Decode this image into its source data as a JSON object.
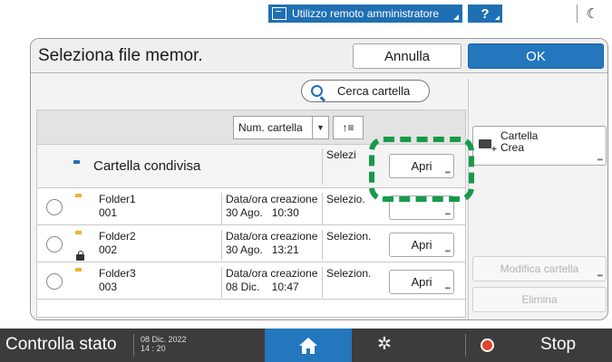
{
  "topbar": {
    "remote_label": "Utilizzo remoto amministratore",
    "help_label": "?",
    "moon_icon": "moon-icon"
  },
  "dialog": {
    "title": "Seleziona file memor.",
    "cancel_label": "Annulla",
    "ok_label": "OK",
    "search_label": "Cerca cartella",
    "sort_label": "Num. cartella",
    "sort_arrow": "▼",
    "sort_dir_label": "↑≡",
    "shared_folder": {
      "name": "Cartella condivisa",
      "select_label": "Selezi",
      "open_label": "Apri"
    },
    "rows": [
      {
        "name": "Folder1",
        "number": "001",
        "date_label": "Data/ora creazione",
        "date": "30 Ago.   10:30",
        "select": "Selezio.",
        "open_label": "",
        "locked": false
      },
      {
        "name": "Folder2",
        "number": "002",
        "date_label": "Data/ora creazione",
        "date": "30 Ago.   13:21",
        "select": "Selezion.",
        "open_label": "Apri",
        "locked": true
      },
      {
        "name": "Folder3",
        "number": "003",
        "date_label": "Data/ora creazione",
        "date": "08 Dic.    10:47",
        "select": "Selezion.",
        "open_label": "Apri",
        "locked": false
      }
    ],
    "sidebar": {
      "create_folder_line1": "Cartella",
      "create_folder_line2": "Crea",
      "edit_folder_label": "Modifica cartella",
      "delete_label": "Elimina"
    }
  },
  "statusbar": {
    "status_label": "Controlla stato",
    "date": "08 Dic. 2022",
    "time": "14 : 20",
    "stop_label": "Stop"
  },
  "colors": {
    "accent": "#2476bd",
    "highlight": "#179a4a",
    "folder_shared": "#1f6fb3",
    "folder": "#f0b330",
    "stop_icon": "#e0442c"
  }
}
